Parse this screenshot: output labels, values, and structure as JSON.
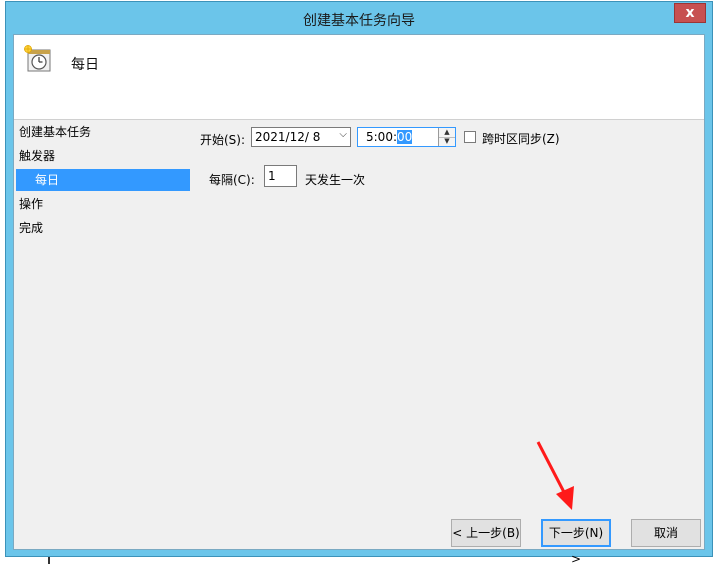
{
  "window": {
    "title": "创建基本任务向导",
    "close_label": "x"
  },
  "header": {
    "title": "每日",
    "icon": "clock-calendar-icon"
  },
  "nav": {
    "items": [
      {
        "label": "创建基本任务"
      },
      {
        "label": "触发器"
      },
      {
        "label": "每日",
        "selected": true
      },
      {
        "label": "操作"
      },
      {
        "label": "完成"
      }
    ]
  },
  "form": {
    "start_label": "开始(S):",
    "start_date": "2021/12/  8",
    "start_time_prefix": "5:00:",
    "start_time_selected": "00",
    "sync_timezone_label": "跨时区同步(Z)",
    "sync_timezone_checked": false,
    "recur_label": "每隔(C):",
    "recur_value": "1",
    "recur_suffix": "天发生一次"
  },
  "buttons": {
    "back": "< 上一步(B)",
    "next": "下一步(N) >",
    "cancel": "取消"
  },
  "colors": {
    "titlebar": "#6bc5ea",
    "selection": "#3399ff",
    "close": "#c75050",
    "annotation_arrow": "#ff1a1a"
  }
}
